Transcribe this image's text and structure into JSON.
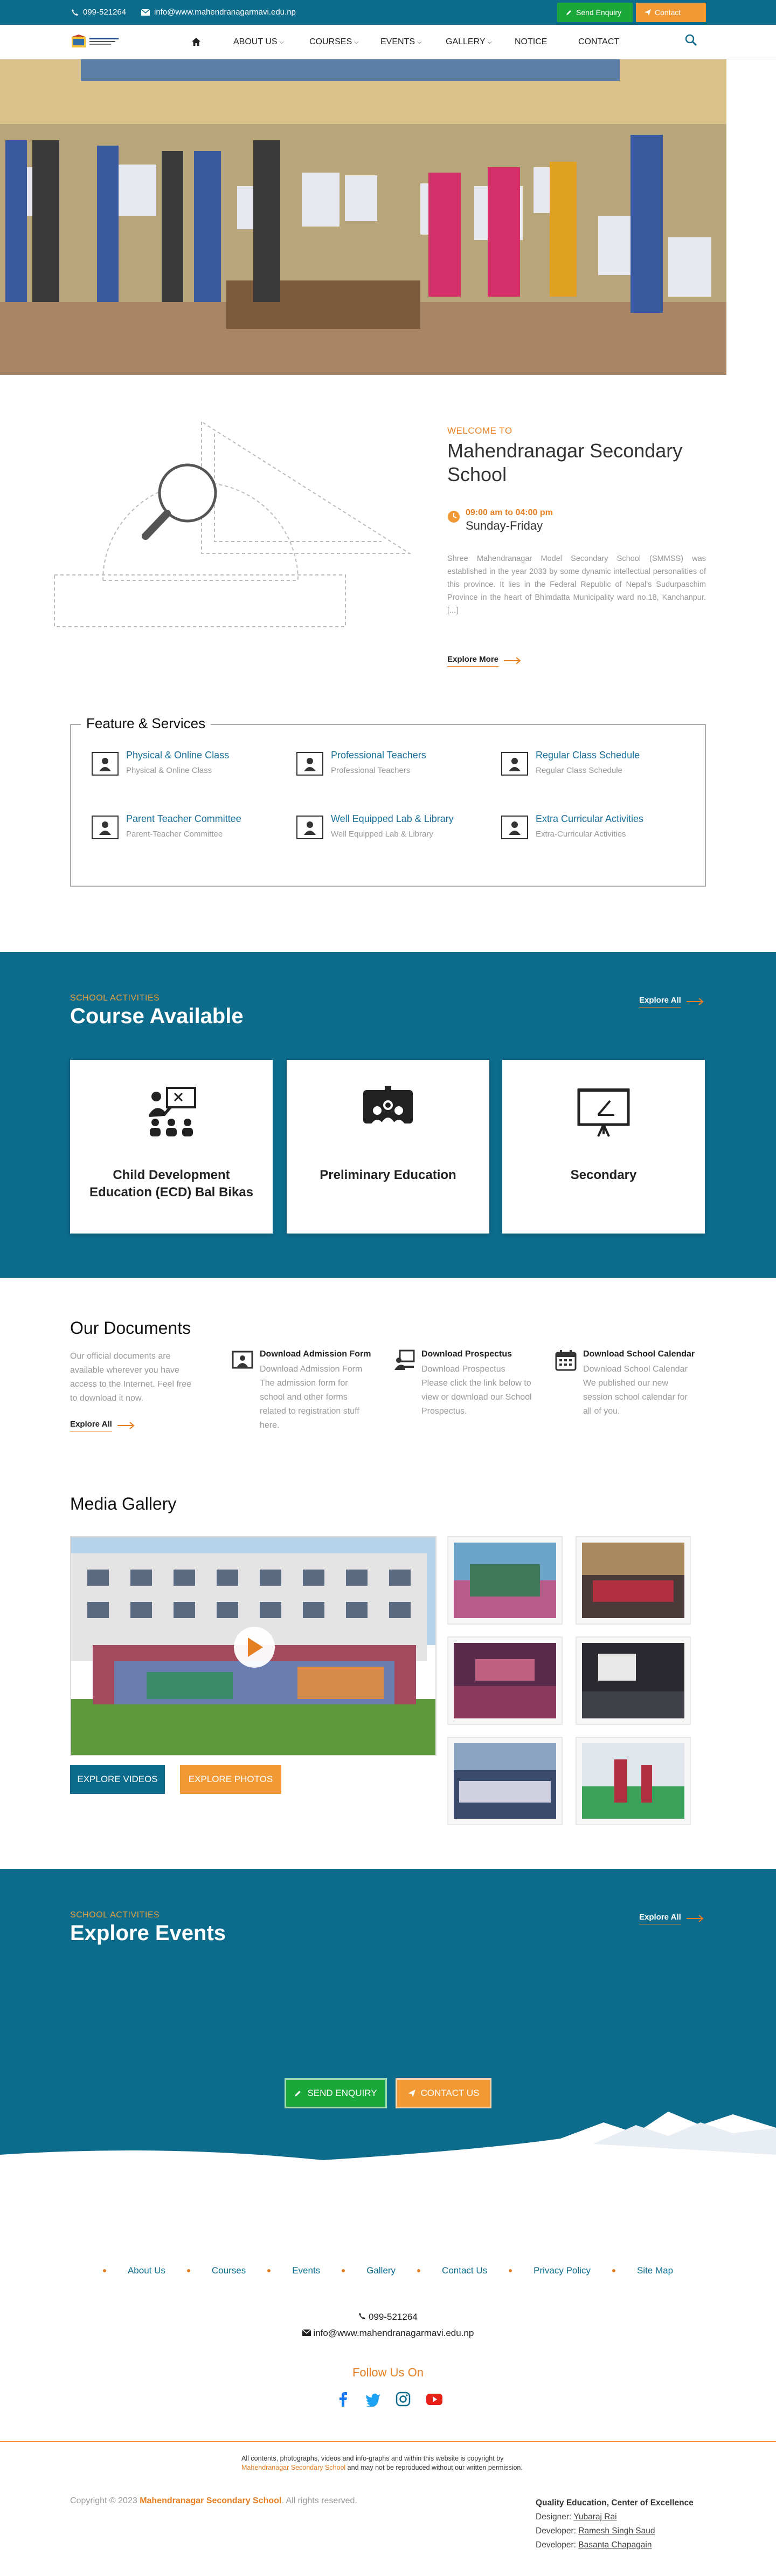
{
  "topbar": {
    "phone": "099-521264",
    "email": "info@www.mahendranagarmavi.edu.np",
    "send_enquiry": "Send Enquiry",
    "contact": "Contact",
    "accent_green": "#1aa83a",
    "accent_orange": "#f19a35",
    "bg": "#0d6b8c"
  },
  "nav": {
    "items": [
      {
        "label": "About Us",
        "dropdown": true
      },
      {
        "label": "Courses",
        "dropdown": true
      },
      {
        "label": "Events",
        "dropdown": true
      },
      {
        "label": "Gallery",
        "dropdown": true
      },
      {
        "label": "Notice",
        "dropdown": false
      },
      {
        "label": "Contact",
        "dropdown": false
      }
    ]
  },
  "welcome": {
    "tag": "WELCOME TO",
    "title": "Mahendranagar Secondary School",
    "time": "09:00 am to 04:00 pm",
    "days": "Sunday-Friday",
    "description": "Shree Mahendranagar Model Secondary School (SMMSS) was established in the year 2033 by some dynamic intellectual personalities of this province. It lies in the Federal Republic of Nepal's Sudurpaschim Province in the heart of Bhimdatta Municipality ward no.18, Kanchanpur.[...]",
    "explore": "Explore More"
  },
  "features": {
    "title": "Feature & Services",
    "items": [
      {
        "title": "Physical & Online Class",
        "sub": "Physical & Online Class"
      },
      {
        "title": "Professional Teachers",
        "sub": "Professional Teachers"
      },
      {
        "title": "Regular Class Schedule",
        "sub": "Regular Class Schedule"
      },
      {
        "title": "Parent Teacher Committee",
        "sub": "Parent-Teacher Committee"
      },
      {
        "title": "Well Equipped Lab & Library",
        "sub": "Well Equipped Lab & Library"
      },
      {
        "title": "Extra Curricular Activities",
        "sub": "Extra-Curricular Activities"
      }
    ]
  },
  "courses": {
    "tag": "SCHOOL ACTIVITIES",
    "title": "Course Available",
    "explore": "Explore All",
    "items": [
      "Child Development Education (ECD) Bal Bikas",
      "Preliminary Education",
      "Secondary"
    ]
  },
  "documents": {
    "title": "Our Documents",
    "intro": "Our official documents are available wherever you have access to the Internet. Feel free to download it now.",
    "explore": "Explore All",
    "items": [
      {
        "title": "Download Admission Form",
        "desc": "Download Admission Form The admission form for school and other forms related to registration stuff here."
      },
      {
        "title": "Download Prospectus",
        "desc": "Download Prospectus Please click the link below to view or download our School Prospectus."
      },
      {
        "title": "Download School Calendar",
        "desc": "Download School Calendar We published our new session school calendar for all of you."
      }
    ]
  },
  "gallery": {
    "title": "Media Gallery",
    "videos_btn": "EXPLORE VIDEOS",
    "photos_btn": "EXPLORE PHOTOS"
  },
  "events": {
    "tag": "SCHOOL ACTIVITIES",
    "title": "Explore Events",
    "explore": "Explore All",
    "enquiry_btn": "SEND ENQUIRY",
    "contact_btn": "CONTACT US"
  },
  "footer": {
    "links": [
      "About Us",
      "Courses",
      "Events",
      "Gallery",
      "Contact Us",
      "Privacy Policy",
      "Site Map"
    ],
    "phone": "099-521264",
    "email": "info@www.mahendranagarmavi.edu.np",
    "follow": "Follow Us On",
    "note_pre": "All contents, photographs, videos and info-graphs and within this website is copyright by",
    "note_school": "Mahendranagar Secondary School",
    "note_post": "and may not be reproduced without our written permission.",
    "copyright_pre": "Copyright © 2023",
    "copyright_school": "Mahendranagar Secondary School",
    "copyright_post": ". All rights reserved.",
    "tagline": "Quality Education, Center of Excellence",
    "designer_label": "Designer:",
    "designer": "Yubaraj Rai",
    "developer_label": "Developer:",
    "developer1": "Ramesh Singh Saud",
    "developer2": "Basanta Chapagain"
  }
}
